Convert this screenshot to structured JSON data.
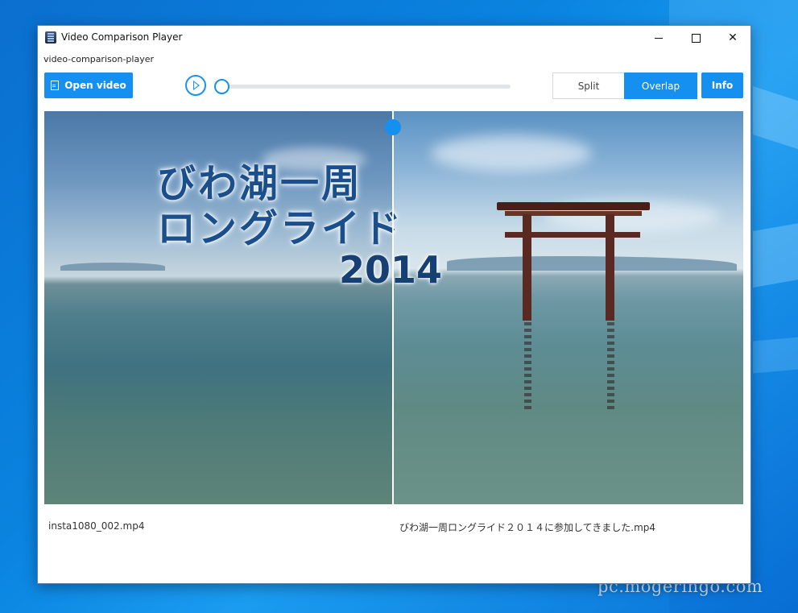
{
  "window": {
    "title": "Video Comparison Player",
    "subtitle": "video-comparison-player"
  },
  "toolbar": {
    "open_label": "Open video",
    "split_label": "Split",
    "overlay_label": "Overlap",
    "info_label": "Info",
    "active_mode": "Overlap",
    "seek_progress": 0
  },
  "video": {
    "overlay_title_line1": "びわ湖一周",
    "overlay_title_line2": "ロングライド",
    "overlay_year": "2014"
  },
  "files": {
    "left": "insta1080_002.mp4",
    "right": "びわ湖一周ロングライド２０１４に参加してきました.mp4"
  },
  "desktop": {
    "watermark": "pc.mogeringo.com"
  },
  "colors": {
    "accent": "#1590f0",
    "window_bg": "#ffffff"
  }
}
